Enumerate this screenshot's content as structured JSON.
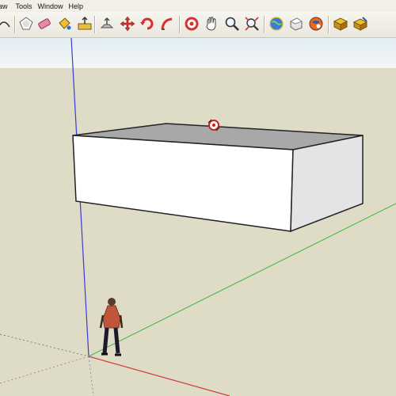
{
  "menus": [
    "raw",
    "Tools",
    "Window",
    "Help"
  ],
  "toolbar": {
    "tools": [
      {
        "name": "arc-tool-icon"
      },
      {
        "name": "shape-tool-icon"
      },
      {
        "name": "eraser-icon"
      },
      {
        "name": "paint-bucket-icon"
      },
      {
        "name": "push-pull-icon"
      },
      {
        "name": "move-icon"
      },
      {
        "name": "rotate-icon"
      },
      {
        "name": "follow-me-icon"
      },
      {
        "name": "orbit-icon"
      },
      {
        "name": "pan-icon"
      },
      {
        "name": "zoom-icon"
      },
      {
        "name": "zoom-extents-icon"
      },
      {
        "name": "get-models-icon"
      },
      {
        "name": "share-model-icon"
      },
      {
        "name": "share-component-icon"
      },
      {
        "name": "components-icon"
      },
      {
        "name": "extension-icon"
      }
    ]
  },
  "colors": {
    "sky": "#e6f0f4",
    "ground": "#dedbc7",
    "axis_red": "#d23a3a",
    "axis_green": "#3cb83c",
    "axis_blue": "#3a3ad8",
    "box_top": "#a8a8a8",
    "box_front": "#ffffff",
    "box_side": "#e4e4e4"
  }
}
